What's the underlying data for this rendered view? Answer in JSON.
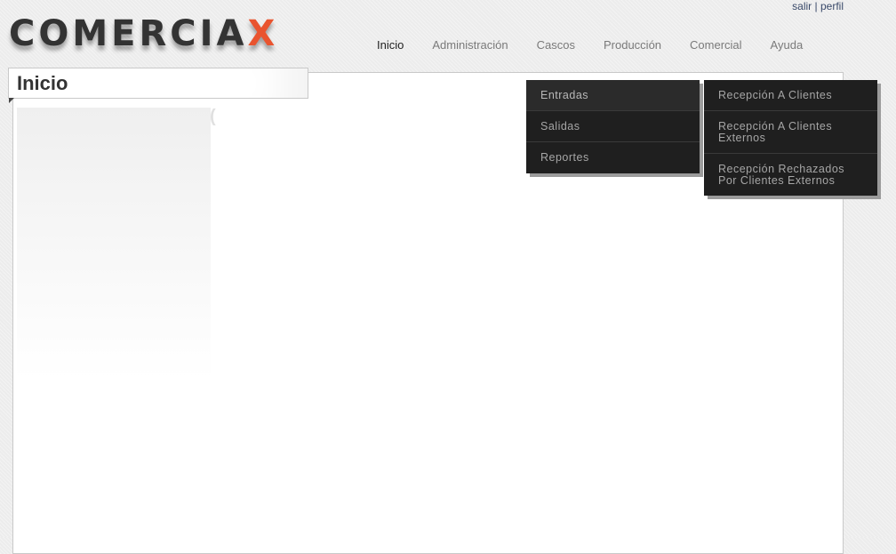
{
  "header": {
    "logo_main": "COMERCIA",
    "logo_accent": "X",
    "logout_link": "salir",
    "separator": "|",
    "profile_link": "perfil"
  },
  "nav": {
    "items": [
      {
        "label": "Inicio",
        "active": true
      },
      {
        "label": "Administración"
      },
      {
        "label": "Cascos"
      },
      {
        "label": "Producción"
      },
      {
        "label": "Comercial"
      },
      {
        "label": "Ayuda"
      }
    ]
  },
  "page": {
    "title": "Inicio"
  },
  "dropdown": {
    "items": [
      {
        "label": "Entradas",
        "highlighted": true
      },
      {
        "label": "Salidas"
      },
      {
        "label": "Reportes"
      }
    ],
    "submenu": [
      {
        "label": "Recepción A Clientes"
      },
      {
        "label": "Recepción A Clientes Externos"
      },
      {
        "label": "Recepción Rechazados Por Clientes Externos"
      }
    ]
  },
  "colors": {
    "accent": "#e9542f",
    "menu_bg": "#1f1f1f"
  }
}
